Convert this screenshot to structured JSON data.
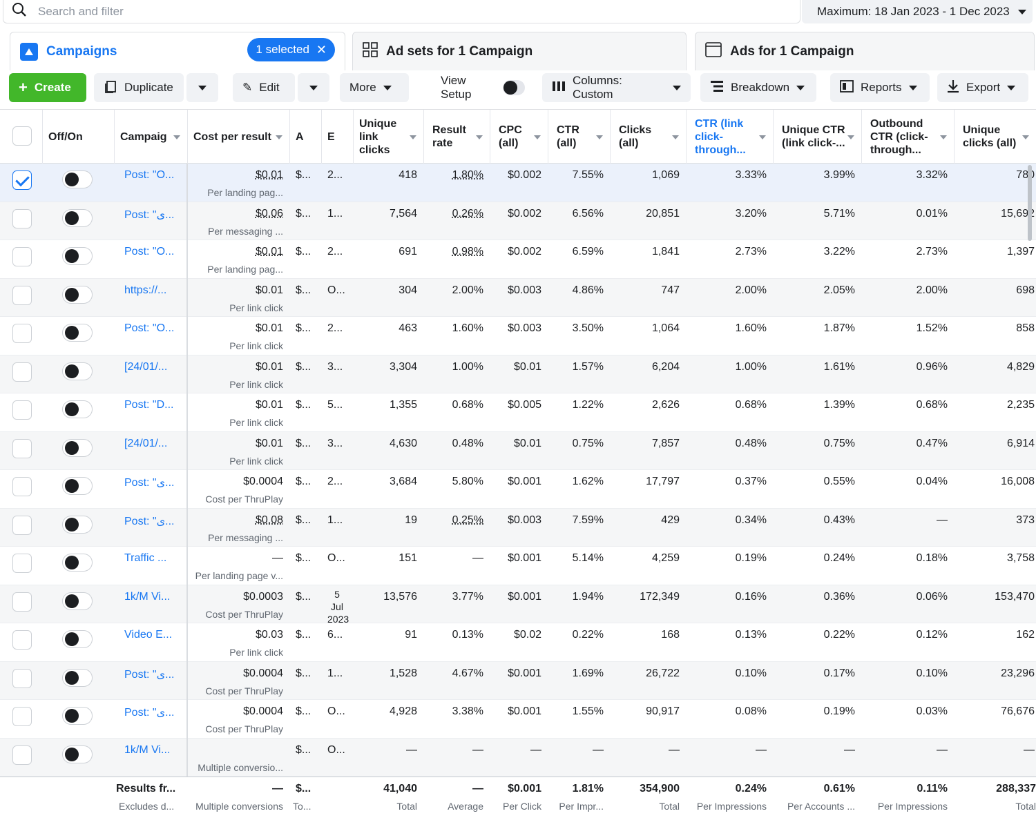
{
  "search": {
    "placeholder": "Search and filter"
  },
  "date_range": {
    "label": "Maximum: 18 Jan 2023 - 1 Dec 2023"
  },
  "tabs": {
    "campaigns": {
      "label": "Campaigns",
      "selected_pill": "1 selected"
    },
    "adsets": {
      "label": "Ad sets for 1 Campaign"
    },
    "ads": {
      "label": "Ads for 1 Campaign"
    }
  },
  "toolbar": {
    "create": "Create",
    "duplicate": "Duplicate",
    "edit": "Edit",
    "more": "More",
    "view_setup": "View Setup",
    "columns": "Columns: Custom",
    "breakdown": "Breakdown",
    "reports": "Reports",
    "export": "Export"
  },
  "colors": {
    "accent": "#1877f2",
    "create": "#42b72a"
  },
  "columns": [
    "Off/On",
    "Campaig",
    "Cost per result",
    "A",
    "E",
    "Unique link clicks",
    "Result rate",
    "CPC (all)",
    "CTR (all)",
    "Clicks (all)",
    "CTR (link click-through...",
    "Unique CTR (link click-...",
    "Outbound CTR (click-through...",
    "Unique clicks (all)"
  ],
  "rows": [
    {
      "name": "Post: \"O...",
      "cpr": "$0.01",
      "cpr_sub": "Per landing pag...",
      "a": "$...",
      "e": "2...",
      "ulc": "418",
      "rr": "1.80%",
      "cpc": "$0.002",
      "ctr": "7.55%",
      "clicks": "1,069",
      "ctr_link": "3.33%",
      "uctr": "3.99%",
      "octr": "3.32%",
      "uclicks": "780",
      "checked": true
    },
    {
      "name": "Post: \"ی...",
      "cpr": "$0.06",
      "cpr_sub": "Per messaging ...",
      "a": "$...",
      "e": "1...",
      "ulc": "7,564",
      "rr": "0.26%",
      "cpc": "$0.002",
      "ctr": "6.56%",
      "clicks": "20,851",
      "ctr_link": "3.20%",
      "uctr": "5.71%",
      "octr": "0.01%",
      "uclicks": "15,692"
    },
    {
      "name": "Post: \"O...",
      "cpr": "$0.01",
      "cpr_sub": "Per landing pag...",
      "a": "$...",
      "e": "2...",
      "ulc": "691",
      "rr": "0.98%",
      "cpc": "$0.002",
      "ctr": "6.59%",
      "clicks": "1,841",
      "ctr_link": "2.73%",
      "uctr": "3.22%",
      "octr": "2.73%",
      "uclicks": "1,397"
    },
    {
      "name": "https://...",
      "cpr": "$0.01",
      "cpr_sub": "Per link click",
      "a": "$...",
      "e": "O...",
      "ulc": "304",
      "rr": "2.00%",
      "cpc": "$0.003",
      "ctr": "4.86%",
      "clicks": "747",
      "ctr_link": "2.00%",
      "uctr": "2.05%",
      "octr": "2.00%",
      "uclicks": "698"
    },
    {
      "name": "Post: \"O...",
      "cpr": "$0.01",
      "cpr_sub": "Per link click",
      "a": "$...",
      "e": "2...",
      "ulc": "463",
      "rr": "1.60%",
      "cpc": "$0.003",
      "ctr": "3.50%",
      "clicks": "1,064",
      "ctr_link": "1.60%",
      "uctr": "1.87%",
      "octr": "1.52%",
      "uclicks": "858"
    },
    {
      "name": "[24/01/...",
      "cpr": "$0.01",
      "cpr_sub": "Per link click",
      "a": "$...",
      "e": "3...",
      "ulc": "3,304",
      "rr": "1.00%",
      "cpc": "$0.01",
      "ctr": "1.57%",
      "clicks": "6,204",
      "ctr_link": "1.00%",
      "uctr": "1.61%",
      "octr": "0.96%",
      "uclicks": "4,829"
    },
    {
      "name": "Post: \"D...",
      "cpr": "$0.01",
      "cpr_sub": "Per link click",
      "a": "$...",
      "e": "5...",
      "ulc": "1,355",
      "rr": "0.68%",
      "cpc": "$0.005",
      "ctr": "1.22%",
      "clicks": "2,626",
      "ctr_link": "0.68%",
      "uctr": "1.39%",
      "octr": "0.68%",
      "uclicks": "2,235"
    },
    {
      "name": "[24/01/...",
      "cpr": "$0.01",
      "cpr_sub": "Per link click",
      "a": "$...",
      "e": "3...",
      "ulc": "4,630",
      "rr": "0.48%",
      "cpc": "$0.01",
      "ctr": "0.75%",
      "clicks": "7,857",
      "ctr_link": "0.48%",
      "uctr": "0.75%",
      "octr": "0.47%",
      "uclicks": "6,914"
    },
    {
      "name": "Post: \"ی...",
      "cpr": "$0.0004",
      "cpr_sub": "Cost per ThruPlay",
      "a": "$...",
      "e": "2...",
      "ulc": "3,684",
      "rr": "5.80%",
      "cpc": "$0.001",
      "ctr": "1.62%",
      "clicks": "17,797",
      "ctr_link": "0.37%",
      "uctr": "0.55%",
      "octr": "0.04%",
      "uclicks": "16,008"
    },
    {
      "name": "Post: \"ی...",
      "cpr": "$0.08",
      "cpr_sub": "Per messaging ...",
      "a": "$...",
      "e": "1...",
      "ulc": "19",
      "rr": "0.25%",
      "cpc": "$0.003",
      "ctr": "7.59%",
      "clicks": "429",
      "ctr_link": "0.34%",
      "uctr": "0.43%",
      "octr": "—",
      "uclicks": "373"
    },
    {
      "name": "Traffic ...",
      "cpr": "—",
      "cpr_sub": "Per landing page v...",
      "a": "$...",
      "e": "O...",
      "ulc": "151",
      "rr": "—",
      "cpc": "$0.001",
      "ctr": "5.14%",
      "clicks": "4,259",
      "ctr_link": "0.19%",
      "uctr": "0.24%",
      "octr": "0.18%",
      "uclicks": "3,758"
    },
    {
      "name": "1k/M Vi...",
      "cpr": "$0.0003",
      "cpr_sub": "Cost per ThruPlay",
      "a": "$...",
      "e": "5 Jul 2023",
      "ulc": "13,576",
      "rr": "3.77%",
      "cpc": "$0.001",
      "ctr": "1.94%",
      "clicks": "172,349",
      "ctr_link": "0.16%",
      "uctr": "0.36%",
      "octr": "0.06%",
      "uclicks": "153,470"
    },
    {
      "name": "Video E...",
      "cpr": "$0.03",
      "cpr_sub": "Per link click",
      "a": "$...",
      "e": "6...",
      "ulc": "91",
      "rr": "0.13%",
      "cpc": "$0.02",
      "ctr": "0.22%",
      "clicks": "168",
      "ctr_link": "0.13%",
      "uctr": "0.22%",
      "octr": "0.12%",
      "uclicks": "162"
    },
    {
      "name": "Post: \"ی...",
      "cpr": "$0.0004",
      "cpr_sub": "Cost per ThruPlay",
      "a": "$...",
      "e": "1...",
      "ulc": "1,528",
      "rr": "4.67%",
      "cpc": "$0.001",
      "ctr": "1.69%",
      "clicks": "26,722",
      "ctr_link": "0.10%",
      "uctr": "0.17%",
      "octr": "0.10%",
      "uclicks": "23,296"
    },
    {
      "name": "Post: \"ی...",
      "cpr": "$0.0004",
      "cpr_sub": "Cost per ThruPlay",
      "a": "$...",
      "e": "O...",
      "ulc": "4,928",
      "rr": "3.38%",
      "cpc": "$0.001",
      "ctr": "1.55%",
      "clicks": "90,917",
      "ctr_link": "0.08%",
      "uctr": "0.19%",
      "octr": "0.03%",
      "uclicks": "76,676"
    },
    {
      "name": "1k/M Vi...",
      "cpr": "",
      "cpr_sub": "Multiple conversio...",
      "a": "$...",
      "e": "O...",
      "ulc": "—",
      "rr": "—",
      "cpc": "—",
      "ctr": "—",
      "clicks": "—",
      "ctr_link": "—",
      "uctr": "—",
      "octr": "—",
      "uclicks": "—"
    }
  ],
  "totals": {
    "name": "Results fr...",
    "name_sub": "Excludes d...",
    "cpr": "—",
    "cpr_sub": "Multiple conversions",
    "a": "$...",
    "a_sub": "To...",
    "ulc": "41,040",
    "ulc_sub": "Total",
    "rr": "—",
    "rr_sub": "Average",
    "cpc": "$0.001",
    "cpc_sub": "Per Click",
    "ctr": "1.81%",
    "ctr_sub": "Per Impr...",
    "clicks": "354,900",
    "clicks_sub": "Total",
    "ctr_link": "0.24%",
    "ctr_link_sub": "Per Impressions",
    "uctr": "0.61%",
    "uctr_sub": "Per Accounts ...",
    "octr": "0.11%",
    "octr_sub": "Per Impressions",
    "uclicks": "288,337",
    "uclicks_sub": "Total"
  }
}
